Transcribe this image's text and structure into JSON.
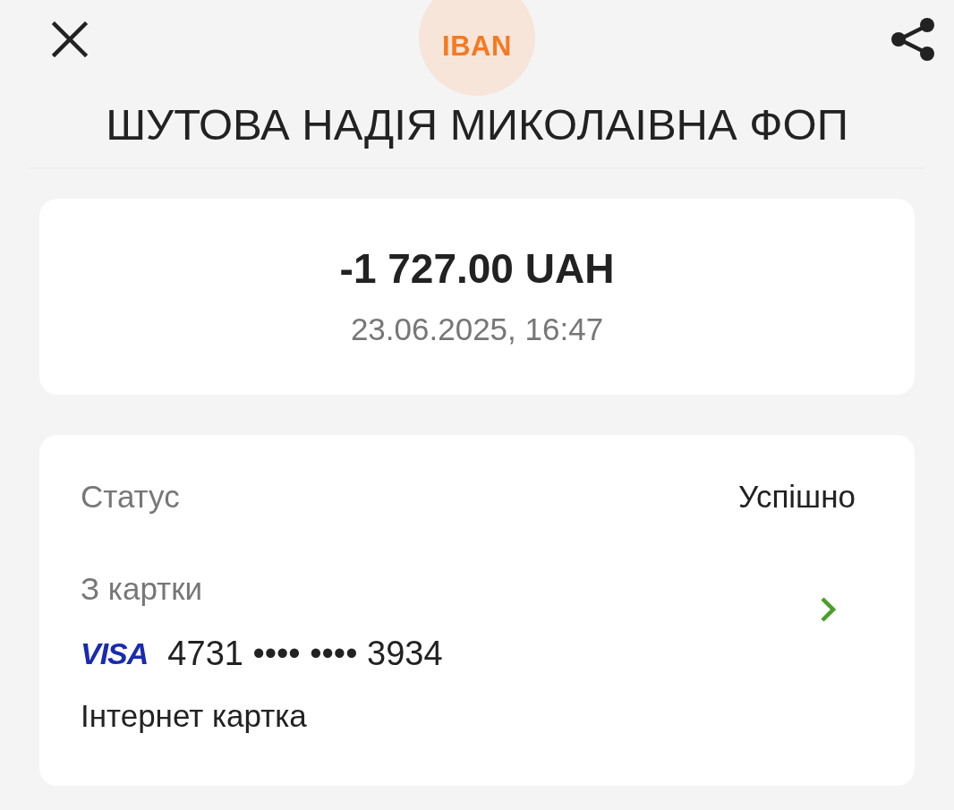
{
  "header": {
    "badge": "IBAN",
    "title": "ШУТОВА НАДІЯ МИКОЛАІВНА ФОП"
  },
  "summary": {
    "amount": "-1 727.00 UAH",
    "datetime": "23.06.2025, 16:47"
  },
  "details": {
    "status": {
      "label": "Статус",
      "value": "Успішно"
    },
    "card": {
      "label": "З картки",
      "network": "VISA",
      "number": "4731 •••• •••• 3934",
      "type": "Інтернет картка"
    }
  }
}
